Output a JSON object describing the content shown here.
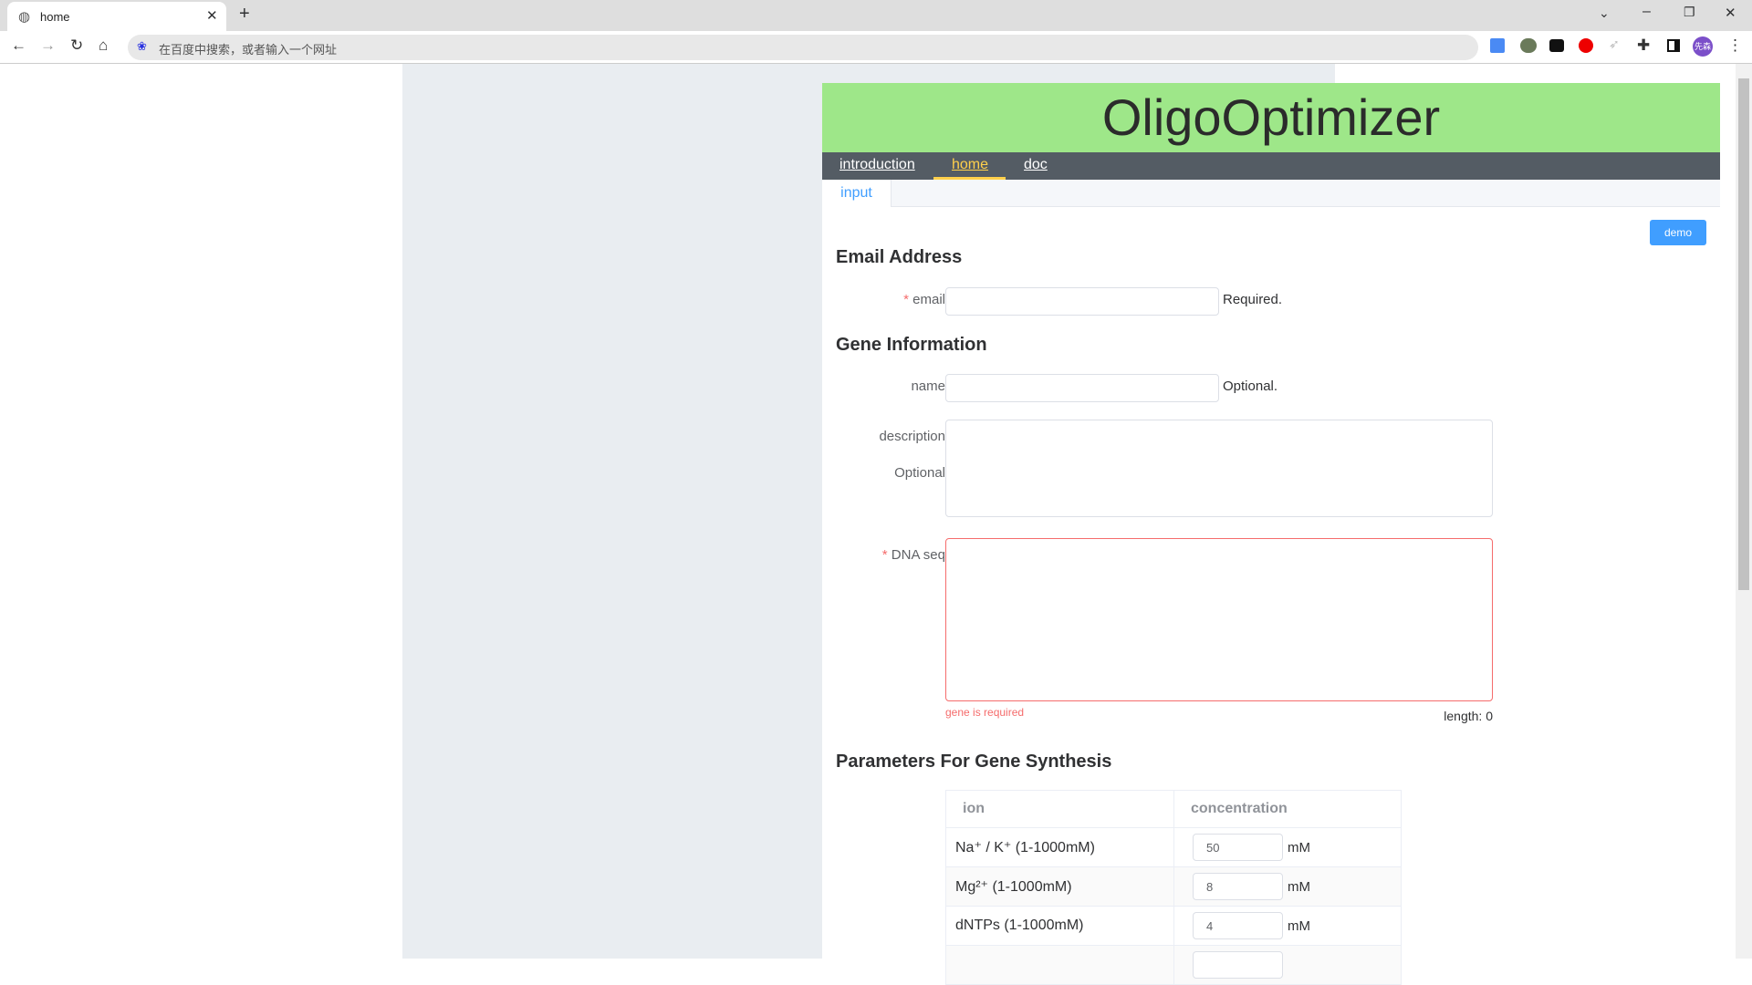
{
  "browser": {
    "tab_title": "home",
    "address_placeholder": "在百度中搜索，或者输入一个网址",
    "profile": "先森",
    "icons": [
      "globe-icon",
      "close-icon",
      "plus-icon",
      "back-icon",
      "forward-icon",
      "reload-icon",
      "home-icon",
      "translate-icon",
      "extension-icon",
      "extensions-puzzle-icon",
      "sidebar-icon",
      "menu-icon"
    ]
  },
  "app": {
    "title": "OligoOptimizer",
    "nav": [
      {
        "label": "introduction"
      },
      {
        "label": "home",
        "active": true
      },
      {
        "label": "doc"
      }
    ],
    "subtab": "input",
    "demo_label": "demo",
    "accent": "#409eff",
    "header_color": "#9ee789",
    "nav_active_color": "#ffd04b"
  },
  "form": {
    "email_section": "Email Address",
    "email_label": "email",
    "email_hint": "Required.",
    "email_value": "",
    "gene_section": "Gene Information",
    "name_label": "name",
    "name_hint": "Optional.",
    "name_value": "",
    "desc_label": "description",
    "desc_hint": "Optional",
    "desc_value": "",
    "dna_label": "DNA seq",
    "dna_value": "",
    "dna_error": "gene is required",
    "length_text": "length: 0",
    "params_section": "Parameters For Gene Synthesis",
    "table": {
      "headers": [
        "ion",
        "concentration"
      ],
      "unit": "mM",
      "rows": [
        {
          "ion": "Na⁺ / K⁺ (1-1000mM)",
          "value": "50"
        },
        {
          "ion": "Mg²⁺ (1-1000mM)",
          "value": "8"
        },
        {
          "ion": "dNTPs (1-1000mM)",
          "value": "4"
        }
      ]
    }
  }
}
